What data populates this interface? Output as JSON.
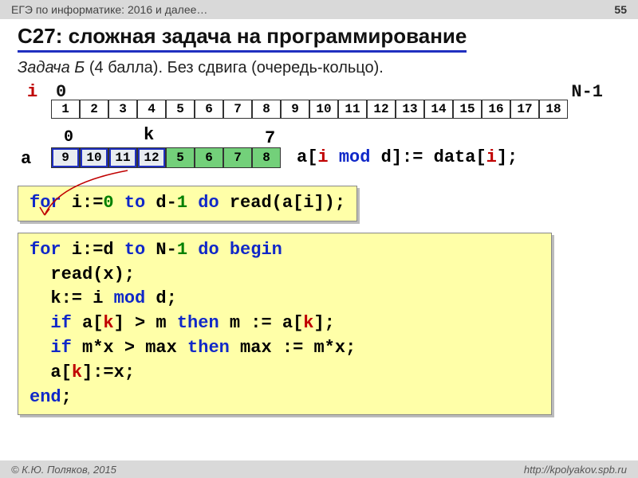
{
  "header": {
    "left": "ЕГЭ по информатике: 2016 и далее…",
    "page": "55"
  },
  "title": "С27: сложная задача на программирование",
  "subtitle": {
    "task": "Задача Б",
    "score": "(4 балла).",
    "desc": "Без сдвига (очередь-кольцо)."
  },
  "labels": {
    "i": "i",
    "zero": "0",
    "nminus1": "N-1",
    "a": "a",
    "a0": "0",
    "k": "k",
    "a7": "7"
  },
  "data_cells": [
    "1",
    "2",
    "3",
    "4",
    "5",
    "6",
    "7",
    "8",
    "9",
    "10",
    "11",
    "12",
    "13",
    "14",
    "15",
    "16",
    "17",
    "18"
  ],
  "a_cells": [
    {
      "v": "9",
      "grey": true
    },
    {
      "v": "10",
      "grey": true
    },
    {
      "v": "11",
      "grey": true
    },
    {
      "v": "12",
      "grey": true
    },
    {
      "v": "5",
      "grey": false
    },
    {
      "v": "6",
      "grey": false
    },
    {
      "v": "7",
      "grey": false
    },
    {
      "v": "8",
      "grey": false
    }
  ],
  "assign": {
    "p1": "a[",
    "i": "i",
    "p2": " ",
    "mod": "mod",
    "p3": " d]:= data[",
    "i2": "i",
    "p4": "];"
  },
  "code1": {
    "for": "for",
    "sp1": " i:=",
    "z": "0",
    "sp2": " ",
    "to": "to",
    "sp3": " d-",
    "one": "1",
    "sp4": " ",
    "do": "do",
    "sp5": " read(a[i]);"
  },
  "code2": {
    "l1a": "for",
    "l1b": " i:=d ",
    "l1c": "to",
    "l1d": " N-",
    "l1e": "1",
    "l1f": " ",
    "l1g": "do",
    "l1h": " ",
    "l1i": "begin",
    "l2": "  read(x);",
    "l3a": "  k:= i ",
    "l3b": "mod",
    "l3c": " d;",
    "l4a": "  ",
    "l4b": "if",
    "l4c": " a[",
    "l4d": "k",
    "l4e": "] > m ",
    "l4f": "then",
    "l4g": " m := a[",
    "l4h": "k",
    "l4i": "];",
    "l5a": "  ",
    "l5b": "if",
    "l5c": " m*x > max ",
    "l5d": "then",
    "l5e": " max := m*x;",
    "l6a": "  a[",
    "l6b": "k",
    "l6c": "]:=x;",
    "l7": "end",
    "l7b": ";"
  },
  "footer": {
    "left": "© К.Ю. Поляков, 2015",
    "right": "http://kpolyakov.spb.ru"
  }
}
